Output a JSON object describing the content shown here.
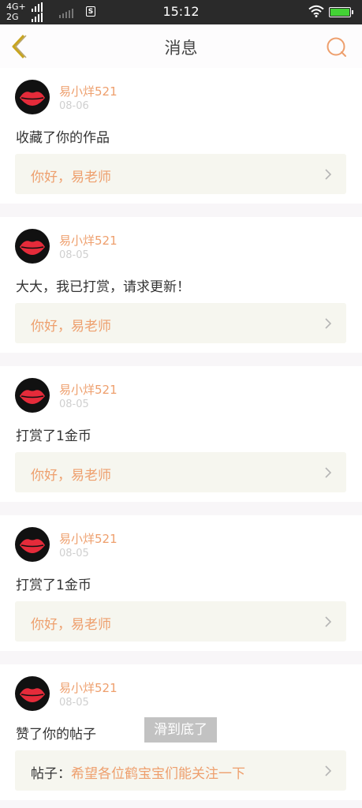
{
  "status_bar": {
    "network_top": "4G+",
    "network_bottom": "2G",
    "sim_icon_label": "S",
    "time": "15:12",
    "battery_color": "#43d235"
  },
  "header": {
    "title": "消息",
    "back_icon": "chevron-left-icon",
    "search_icon": "search-icon"
  },
  "messages": [
    {
      "user": "易小烊521",
      "date": "08-06",
      "action": "收藏了你的作品",
      "reply_prefix": "",
      "reply": "你好，易老师"
    },
    {
      "user": "易小烊521",
      "date": "08-05",
      "action": "大大，我已打赏，请求更新！",
      "reply_prefix": "",
      "reply": "你好，易老师"
    },
    {
      "user": "易小烊521",
      "date": "08-05",
      "action": "打赏了1金币",
      "reply_prefix": "",
      "reply": "你好，易老师"
    },
    {
      "user": "易小烊521",
      "date": "08-05",
      "action": "打赏了1金币",
      "reply_prefix": "",
      "reply": "你好，易老师"
    },
    {
      "user": "易小烊521",
      "date": "08-05",
      "action": "赞了你的帖子",
      "reply_prefix": "帖子：",
      "reply": "希望各位鹤宝宝们能关注一下"
    }
  ],
  "toast": "滑到底了",
  "colors": {
    "accent": "#ee9f6d",
    "reply_bg": "#f6f6ef",
    "back_arrow": "#c8a520"
  }
}
